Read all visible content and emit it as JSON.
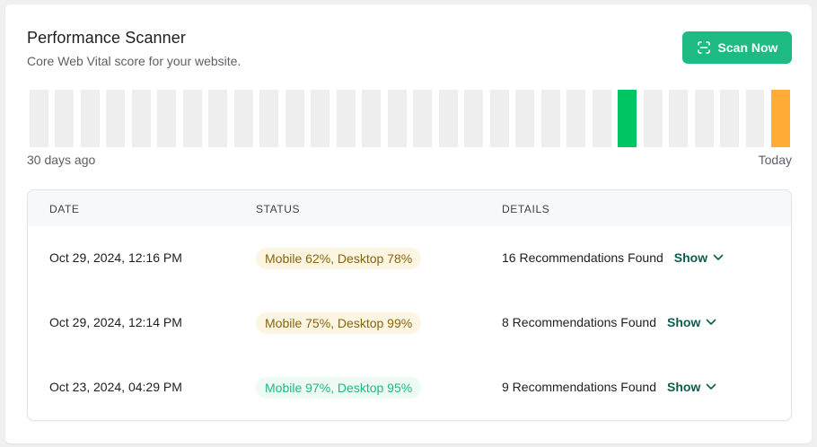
{
  "header": {
    "title": "Performance Scanner",
    "subtitle": "Core Web Vital score for your website.",
    "scan_button_label": "Scan Now",
    "scan_icon": "scan-icon"
  },
  "history": {
    "start_label": "30 days ago",
    "end_label": "Today",
    "bars": [
      {
        "status": "empty"
      },
      {
        "status": "empty"
      },
      {
        "status": "empty"
      },
      {
        "status": "empty"
      },
      {
        "status": "empty"
      },
      {
        "status": "empty"
      },
      {
        "status": "empty"
      },
      {
        "status": "empty"
      },
      {
        "status": "empty"
      },
      {
        "status": "empty"
      },
      {
        "status": "empty"
      },
      {
        "status": "empty"
      },
      {
        "status": "empty"
      },
      {
        "status": "empty"
      },
      {
        "status": "empty"
      },
      {
        "status": "empty"
      },
      {
        "status": "empty"
      },
      {
        "status": "empty"
      },
      {
        "status": "empty"
      },
      {
        "status": "empty"
      },
      {
        "status": "empty"
      },
      {
        "status": "empty"
      },
      {
        "status": "empty"
      },
      {
        "status": "good"
      },
      {
        "status": "empty"
      },
      {
        "status": "empty"
      },
      {
        "status": "empty"
      },
      {
        "status": "empty"
      },
      {
        "status": "empty"
      },
      {
        "status": "warn"
      }
    ],
    "colors": {
      "empty": "#eeeeef",
      "good": "#00c563",
      "warn": "#ffab36"
    }
  },
  "table": {
    "columns": [
      "DATE",
      "STATUS",
      "DETAILS"
    ],
    "rows": [
      {
        "date": "Oct 29, 2024, 12:16 PM",
        "status": "Mobile 62%, Desktop 78%",
        "status_level": "warn",
        "details": "16 Recommendations Found",
        "action": "Show"
      },
      {
        "date": "Oct 29, 2024, 12:14 PM",
        "status": "Mobile 75%, Desktop 99%",
        "status_level": "warn",
        "details": "8 Recommendations Found",
        "action": "Show"
      },
      {
        "date": "Oct 23, 2024, 04:29 PM",
        "status": "Mobile 97%, Desktop 95%",
        "status_level": "good",
        "details": "9 Recommendations Found",
        "action": "Show"
      }
    ]
  }
}
